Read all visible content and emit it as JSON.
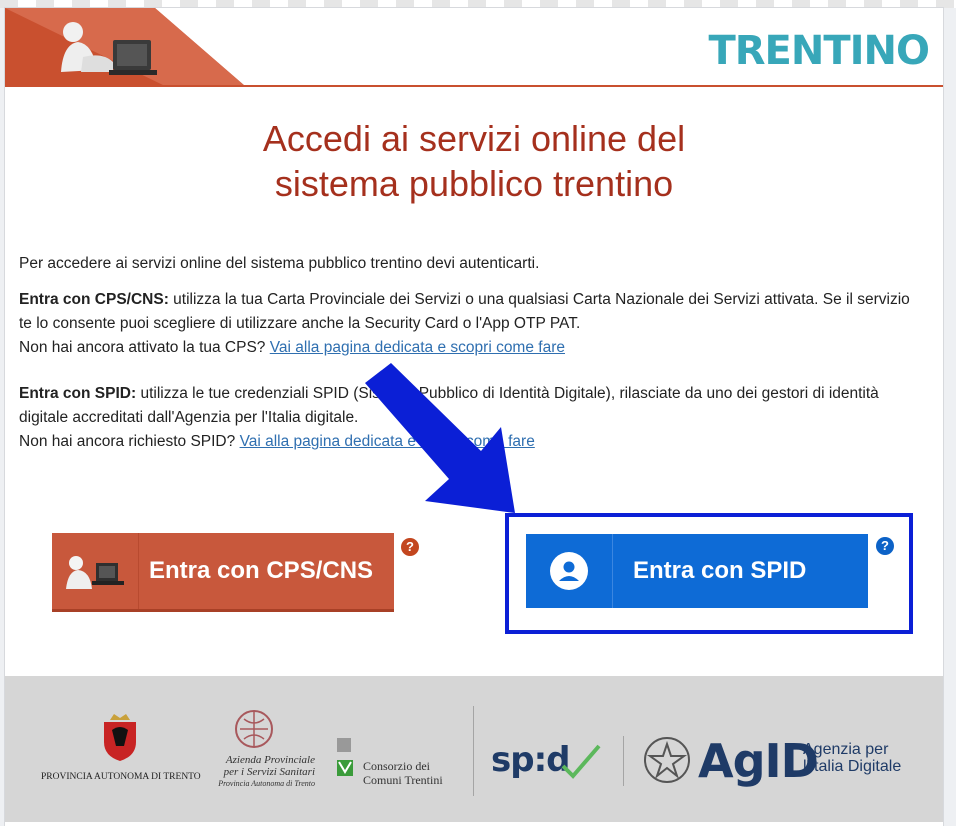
{
  "header": {
    "brand": "TRENTINO"
  },
  "title": {
    "line1": "Accedi ai servizi online del",
    "line2": "sistema pubblico trentino"
  },
  "intro": "Per accedere ai servizi online del sistema pubblico trentino devi autenticarti.",
  "cps_block": {
    "lead": "Entra con CPS/CNS:",
    "text": " utilizza la tua Carta Provinciale dei Servizi o una qualsiasi Carta Nazionale dei Servizi attivata. Se il servizio te lo consente puoi scegliere di utilizzare anche la Security Card o l'App OTP PAT.",
    "question": "Non hai ancora attivato la tua CPS? ",
    "link": "Vai alla pagina dedicata e scopri come fare"
  },
  "spid_block": {
    "lead": "Entra con SPID:",
    "text": " utilizza le tue credenziali SPID (Sistema Pubblico di Identità Digitale), rilasciate da uno dei gestori di identità digitale accreditati dall'Agenzia per l'Italia digitale.",
    "question": "Non hai ancora richiesto SPID? ",
    "link": "Vai alla pagina dedicata e scopri come fare"
  },
  "buttons": {
    "cps_label": "Entra con CPS/CNS",
    "spid_label": "Entra con SPID",
    "help_symbol": "?"
  },
  "footer": {
    "provincia": "PROVINCIA AUTONOMA DI TRENTO",
    "azienda_line1": "Azienda Provinciale",
    "azienda_line2": "per i Servizi Sanitari",
    "azienda_line3": "Provincia Autonoma di Trento",
    "consorzio_line1": "Consorzio dei",
    "consorzio_line2": "Comuni Trentini",
    "spid_logo": "sp:d",
    "agid_logo": "AgID",
    "agid_sub1": "Agenzia per",
    "agid_sub2": "l'Italia Digitale"
  },
  "colors": {
    "title": "#a5301d",
    "cps_button": "#c8583c",
    "spid_button": "#0e6bd6",
    "highlight_frame": "#0b1fd6",
    "footer_bg": "#d6d6d6"
  }
}
